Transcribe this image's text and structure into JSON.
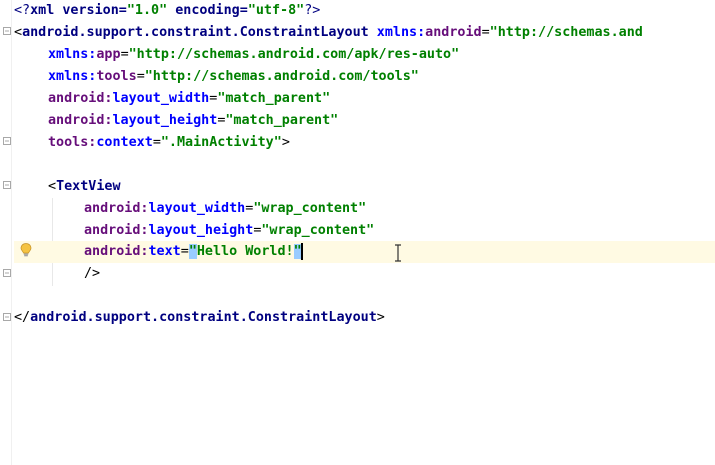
{
  "editor": {
    "line1": {
      "p1": "<?",
      "p2": "xml version=",
      "p3": "\"1.0\"",
      "p4": " encoding=",
      "p5": "\"utf-8\"",
      "p6": "?>"
    },
    "line2": {
      "open": "<",
      "tag": "android.support.constraint.ConstraintLayout",
      "ns": " xmlns:",
      "attr": "android",
      "eq": "=",
      "val": "\"http://schemas.and"
    },
    "line3": {
      "ns": "xmlns:",
      "attr": "app",
      "eq": "=",
      "val": "\"http://schemas.android.com/apk/res-auto\""
    },
    "line4": {
      "ns": "xmlns:",
      "attr": "tools",
      "eq": "=",
      "val": "\"http://schemas.android.com/tools\""
    },
    "line5": {
      "ns": "android:",
      "attr": "layout_width",
      "eq": "=",
      "val": "\"match_parent\""
    },
    "line6": {
      "ns": "android:",
      "attr": "layout_height",
      "eq": "=",
      "val": "\"match_parent\""
    },
    "line7": {
      "ns": "tools:",
      "attr": "context",
      "eq": "=",
      "val": "\".MainActivity\"",
      "close": ">"
    },
    "line9": {
      "open": "<",
      "tag": "TextView"
    },
    "line10": {
      "ns": "android:",
      "attr": "layout_width",
      "eq": "=",
      "val": "\"wrap_content\""
    },
    "line11": {
      "ns": "android:",
      "attr": "layout_height",
      "eq": "=",
      "val": "\"wrap_content\""
    },
    "line12": {
      "ns": "android:",
      "attr": "text",
      "eq": "=",
      "q1": "\"",
      "val": "Hello World!",
      "q2": "\""
    },
    "line13": {
      "close": "/>"
    },
    "line15": {
      "open": "</",
      "tag": "android.support.constraint.ConstraintLayout",
      "close": ">"
    }
  },
  "icons": {
    "intention": "lightbulb-icon",
    "fold": "fold-marker-icon",
    "cursor": "text-cursor-icon"
  },
  "colors": {
    "tag": "#000080",
    "namespace": "#660e7a",
    "attribute": "#0000ff",
    "value": "#008000",
    "current_line": "#fffae3",
    "match_highlight": "#99ccff"
  }
}
